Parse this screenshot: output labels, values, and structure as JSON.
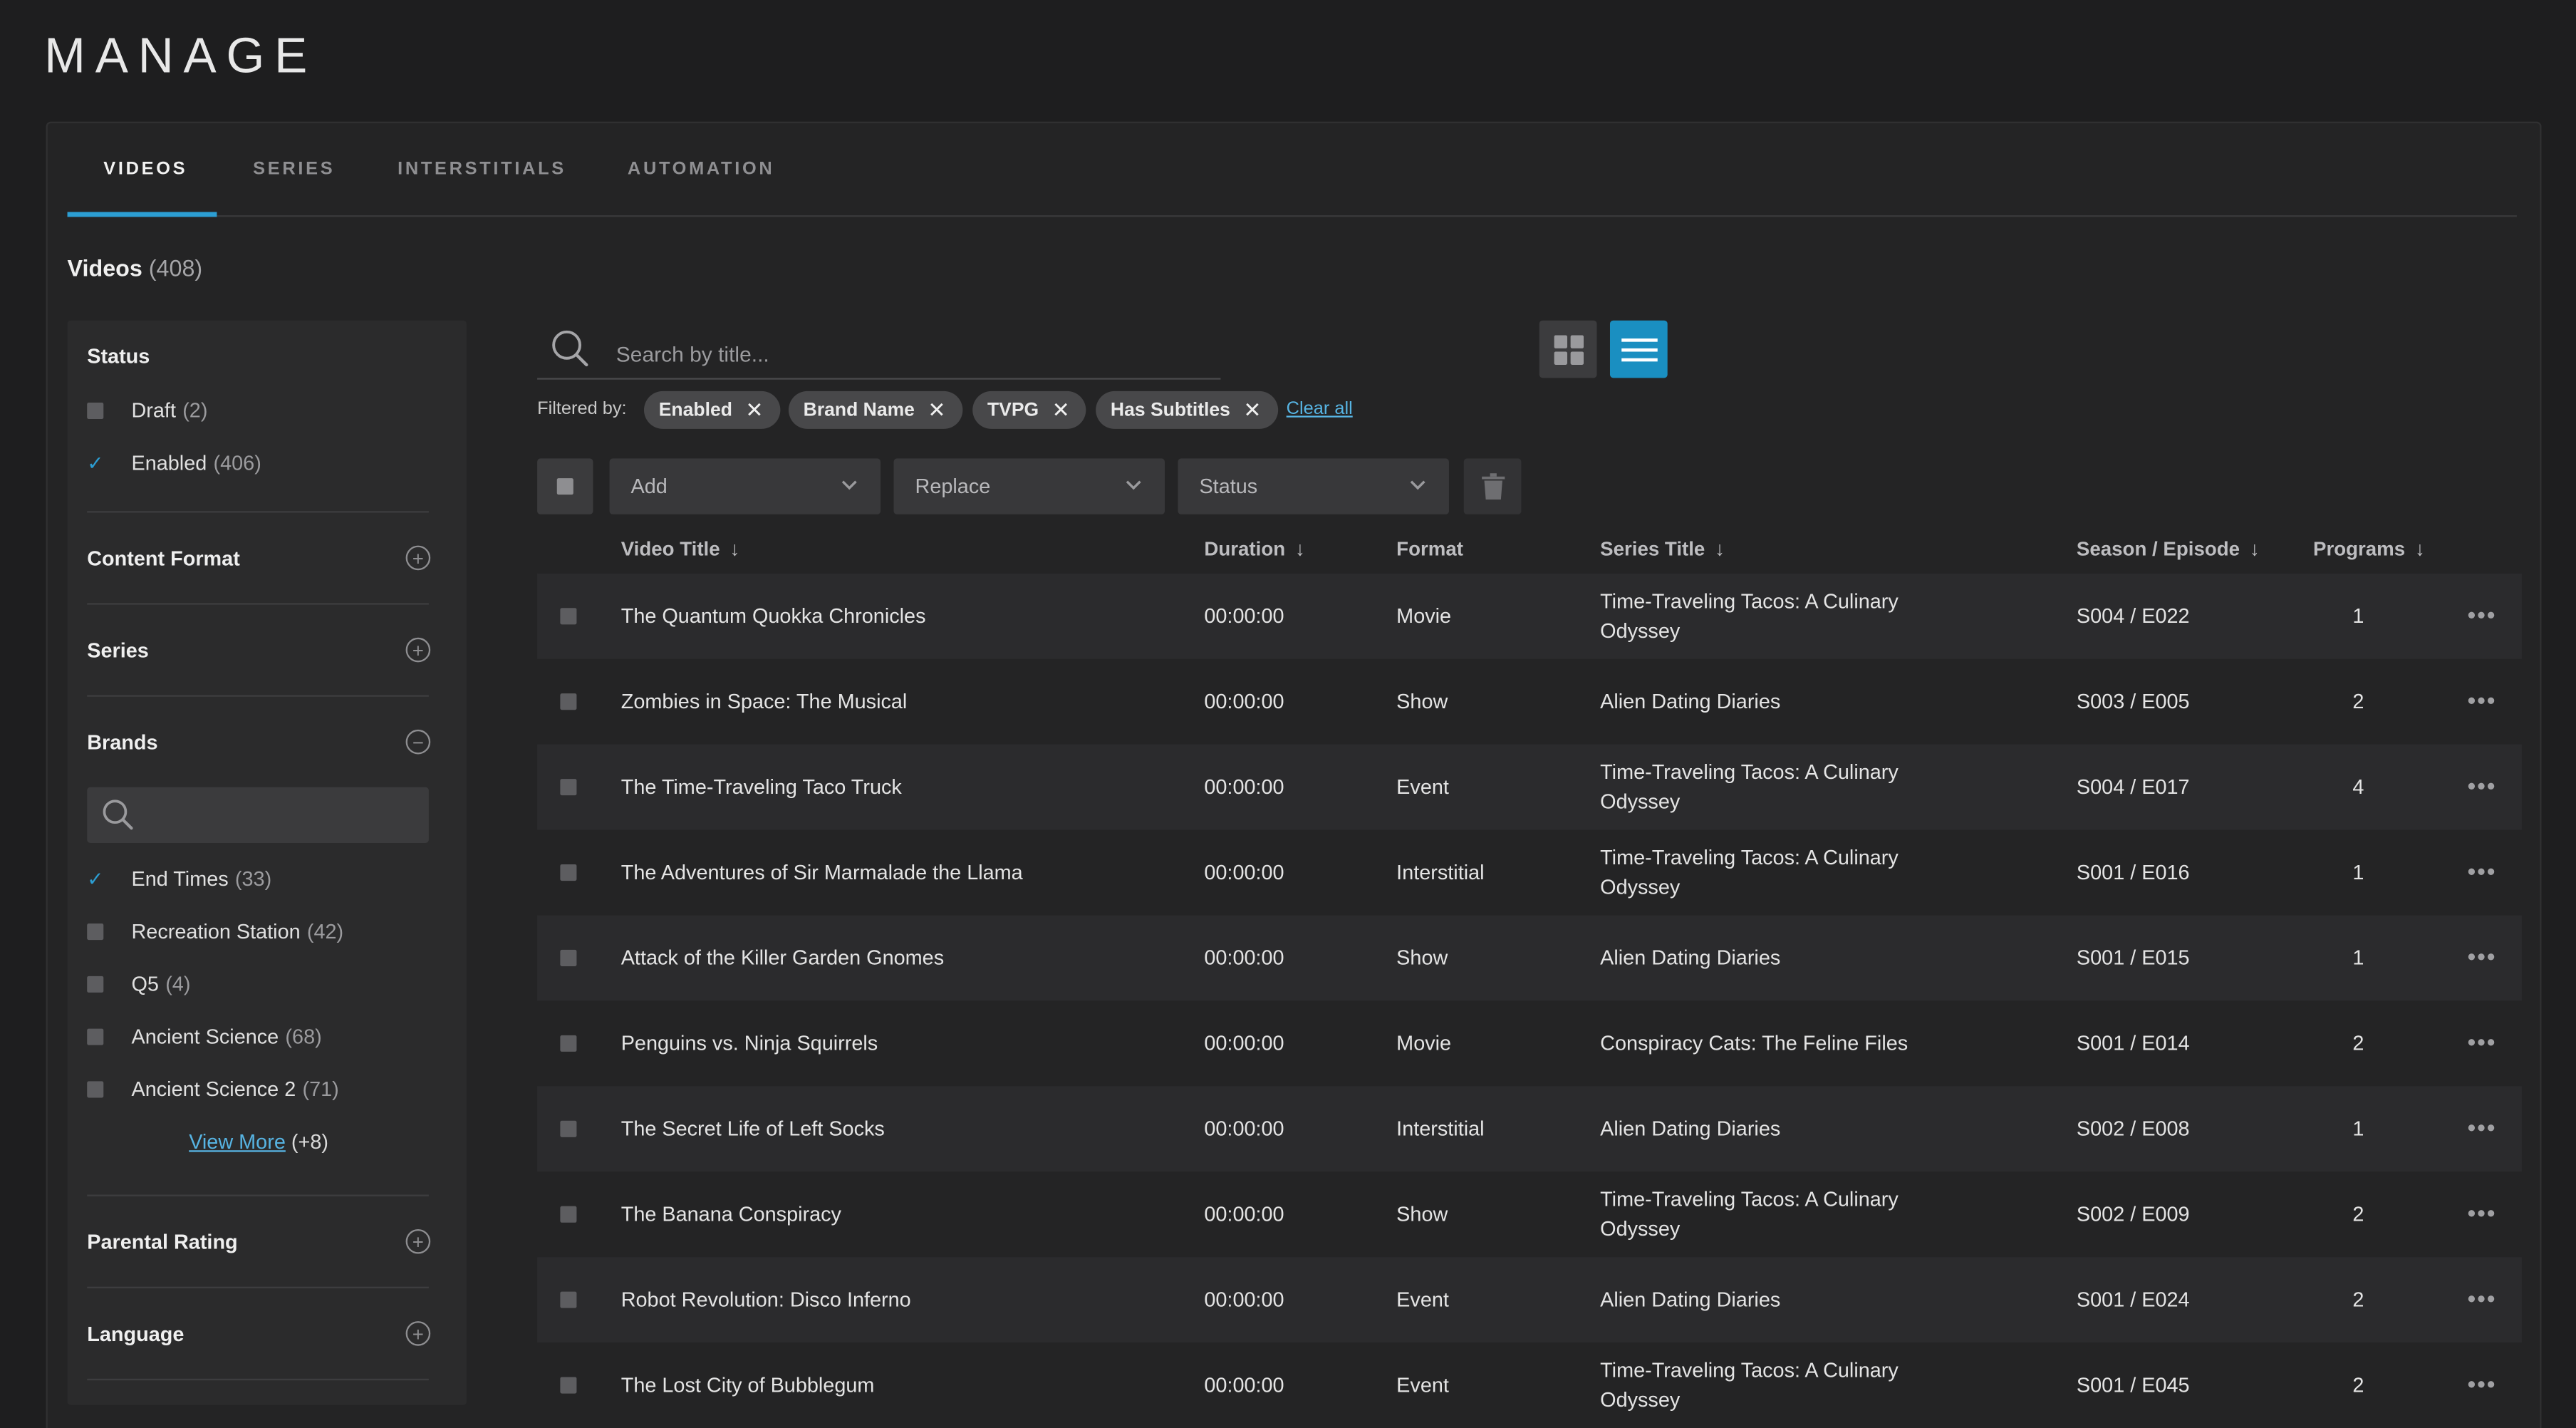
{
  "page": {
    "title": "MANAGE"
  },
  "tabs": [
    {
      "label": "VIDEOS",
      "active": true
    },
    {
      "label": "SERIES",
      "active": false
    },
    {
      "label": "INTERSTITIALS",
      "active": false
    },
    {
      "label": "AUTOMATION",
      "active": false
    }
  ],
  "heading": {
    "label": "Videos",
    "count": "(408)"
  },
  "sidebar": {
    "status": {
      "title": "Status",
      "options": [
        {
          "label": "Draft",
          "count": "(2)",
          "checked": false
        },
        {
          "label": "Enabled",
          "count": "(406)",
          "checked": true
        }
      ]
    },
    "content_format": {
      "title": "Content Format"
    },
    "series": {
      "title": "Series"
    },
    "brands": {
      "title": "Brands",
      "search_placeholder": "",
      "options": [
        {
          "label": "End Times",
          "count": "(33)",
          "checked": true
        },
        {
          "label": "Recreation Station",
          "count": "(42)",
          "checked": false
        },
        {
          "label": "Q5",
          "count": "(4)",
          "checked": false
        },
        {
          "label": "Ancient Science",
          "count": "(68)",
          "checked": false
        },
        {
          "label": "Ancient Science 2",
          "count": "(71)",
          "checked": false
        }
      ],
      "view_more_label": "View More",
      "view_more_count": "(+8)"
    },
    "parental_rating": {
      "title": "Parental Rating"
    },
    "language": {
      "title": "Language"
    }
  },
  "search": {
    "placeholder": "Search by title..."
  },
  "filters": {
    "label": "Filtered by:",
    "chips": [
      "Enabled",
      "Brand Name",
      "TVPG",
      "Has Subtitles"
    ],
    "clear_label": "Clear all"
  },
  "toolbar": {
    "add_label": "Add",
    "replace_label": "Replace",
    "status_label": "Status"
  },
  "table": {
    "headers": {
      "title": "Video Title",
      "duration": "Duration",
      "format": "Format",
      "series": "Series Title",
      "season": "Season / Episode",
      "programs": "Programs"
    },
    "rows": [
      {
        "title": "The Quantum Quokka Chronicles",
        "duration": "00:00:00",
        "format": "Movie",
        "series": "Time-Traveling Tacos: A Culinary Odyssey",
        "season": "S004 / E022",
        "programs": "1"
      },
      {
        "title": "Zombies in Space: The Musical",
        "duration": "00:00:00",
        "format": "Show",
        "series": "Alien Dating Diaries",
        "season": "S003 / E005",
        "programs": "2"
      },
      {
        "title": "The Time-Traveling Taco Truck",
        "duration": "00:00:00",
        "format": "Event",
        "series": "Time-Traveling Tacos: A Culinary Odyssey",
        "season": "S004 / E017",
        "programs": "4"
      },
      {
        "title": "The Adventures of Sir Marmalade the Llama",
        "duration": "00:00:00",
        "format": "Interstitial",
        "series": "Time-Traveling Tacos: A Culinary Odyssey",
        "season": "S001 / E016",
        "programs": "1"
      },
      {
        "title": "Attack of the Killer Garden Gnomes",
        "duration": "00:00:00",
        "format": "Show",
        "series": "Alien Dating Diaries",
        "season": "S001 / E015",
        "programs": "1"
      },
      {
        "title": "Penguins vs. Ninja Squirrels",
        "duration": "00:00:00",
        "format": "Movie",
        "series": "Conspiracy Cats: The Feline Files",
        "season": "S001 / E014",
        "programs": "2"
      },
      {
        "title": "The Secret Life of Left Socks",
        "duration": "00:00:00",
        "format": "Interstitial",
        "series": "Alien Dating Diaries",
        "season": "S002 / E008",
        "programs": "1"
      },
      {
        "title": "The Banana Conspiracy",
        "duration": "00:00:00",
        "format": "Show",
        "series": "Time-Traveling Tacos: A Culinary Odyssey",
        "season": "S002 / E009",
        "programs": "2"
      },
      {
        "title": "Robot Revolution: Disco Inferno",
        "duration": "00:00:00",
        "format": "Event",
        "series": "Alien Dating Diaries",
        "season": "S001 / E024",
        "programs": "2"
      },
      {
        "title": "The Lost City of Bubblegum",
        "duration": "00:00:00",
        "format": "Event",
        "series": "Time-Traveling Tacos: A Culinary Odyssey",
        "season": "S001 / E045",
        "programs": "2"
      }
    ]
  },
  "colors": {
    "accent": "#2c9ed3",
    "background": "#1e1e1f",
    "panel": "#242425"
  }
}
